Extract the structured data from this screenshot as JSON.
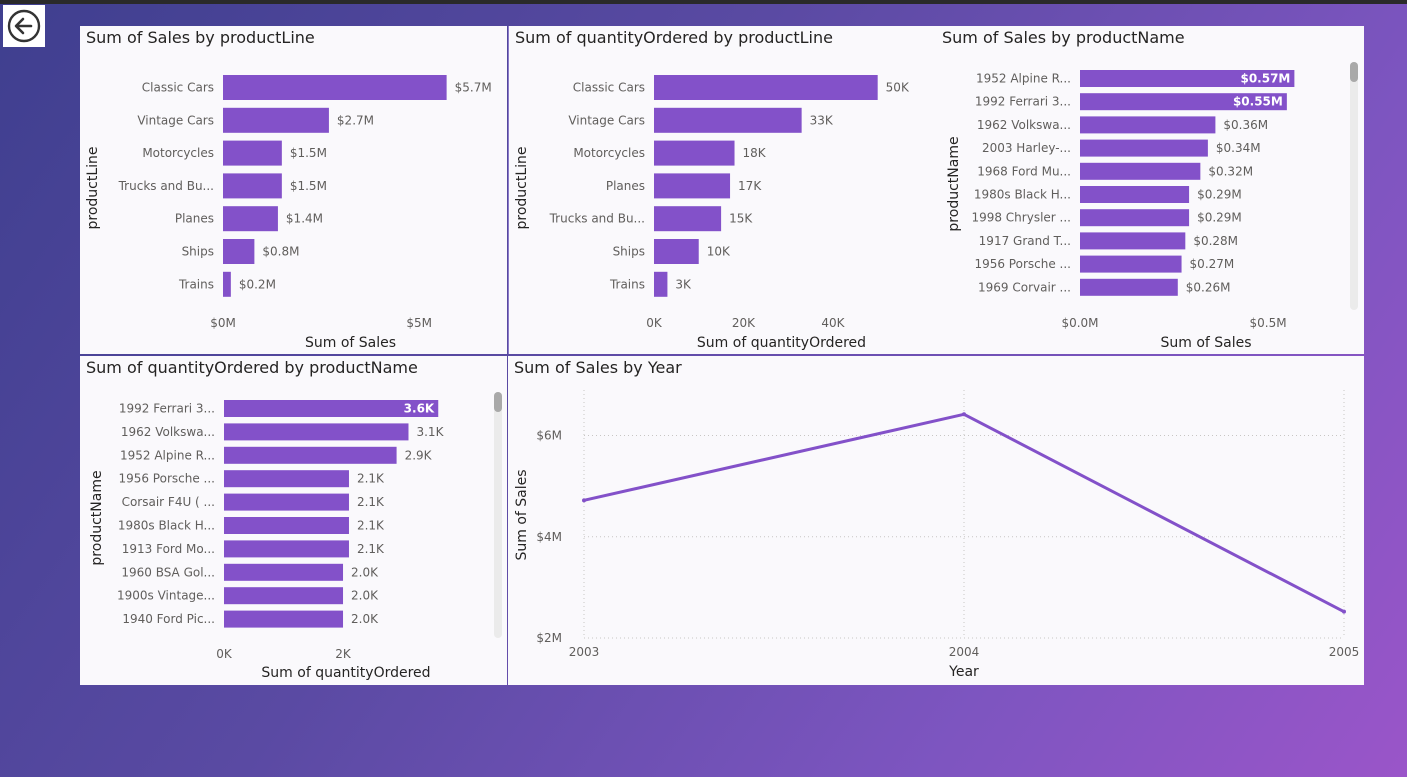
{
  "colors": {
    "bar": "#8351c9",
    "line": "#8351c9",
    "panel_bg": "#faf9fc",
    "text": "#605e5c"
  },
  "icons": {
    "back": "arrow-left-circle-icon"
  },
  "charts": [
    {
      "title": "Sum of Sales by productLine",
      "type": "bar",
      "orientation": "horizontal",
      "xlabel": "Sum of Sales",
      "ylabel": "productLine",
      "xlim": [
        0,
        6.5
      ],
      "x_ticks": [
        {
          "value": 0,
          "label": "$0M"
        },
        {
          "value": 5,
          "label": "$5M"
        }
      ],
      "categories": [
        "Classic Cars",
        "Vintage Cars",
        "Motorcycles",
        "Trucks and Bu...",
        "Planes",
        "Ships",
        "Trains"
      ],
      "values": [
        5.7,
        2.7,
        1.5,
        1.5,
        1.4,
        0.8,
        0.2
      ],
      "value_labels": [
        "$5.7M",
        "$2.7M",
        "$1.5M",
        "$1.5M",
        "$1.4M",
        "$0.8M",
        "$0.2M"
      ]
    },
    {
      "title": "Sum of quantityOrdered by productLine",
      "type": "bar",
      "orientation": "horizontal",
      "xlabel": "Sum of quantityOrdered",
      "ylabel": "productLine",
      "xlim": [
        0,
        57
      ],
      "x_ticks": [
        {
          "value": 0,
          "label": "0K"
        },
        {
          "value": 20,
          "label": "20K"
        },
        {
          "value": 40,
          "label": "40K"
        }
      ],
      "categories": [
        "Classic Cars",
        "Vintage Cars",
        "Motorcycles",
        "Planes",
        "Trucks and Bu...",
        "Ships",
        "Trains"
      ],
      "values": [
        50,
        33,
        18,
        17,
        15,
        10,
        3
      ],
      "value_labels": [
        "50K",
        "33K",
        "18K",
        "17K",
        "15K",
        "10K",
        "3K"
      ]
    },
    {
      "title": "Sum of Sales by productName",
      "type": "bar",
      "orientation": "horizontal",
      "xlabel": "Sum of Sales",
      "ylabel": "productName",
      "xlim": [
        0,
        0.67
      ],
      "x_ticks": [
        {
          "value": 0,
          "label": "$0.0M"
        },
        {
          "value": 0.5,
          "label": "$0.5M"
        }
      ],
      "categories": [
        "1952 Alpine R...",
        "1992 Ferrari 3...",
        "1962 Volkswa...",
        "2003 Harley-...",
        "1968 Ford Mu...",
        "1980s Black H...",
        "1998 Chrysler ...",
        "1917 Grand T...",
        "1956 Porsche ...",
        "1969 Corvair ..."
      ],
      "values": [
        0.57,
        0.55,
        0.36,
        0.34,
        0.32,
        0.29,
        0.29,
        0.28,
        0.27,
        0.26
      ],
      "value_labels": [
        "$0.57M",
        "$0.55M",
        "$0.36M",
        "$0.34M",
        "$0.32M",
        "$0.29M",
        "$0.29M",
        "$0.28M",
        "$0.27M",
        "$0.26M"
      ],
      "inside_labels": 2
    },
    {
      "title": "Sum of quantityOrdered by productName",
      "type": "bar",
      "orientation": "horizontal",
      "xlabel": "Sum of quantityOrdered",
      "ylabel": "productName",
      "xlim": [
        0,
        4.1
      ],
      "x_ticks": [
        {
          "value": 0,
          "label": "0K"
        },
        {
          "value": 2,
          "label": "2K"
        }
      ],
      "categories": [
        "1992 Ferrari 3...",
        "1962 Volkswa...",
        "1952 Alpine R...",
        "1956 Porsche ...",
        "Corsair F4U ( ...",
        "1980s Black H...",
        "1913 Ford Mo...",
        "1960 BSA Gol...",
        "1900s Vintage...",
        "1940 Ford Pic..."
      ],
      "values": [
        3.6,
        3.1,
        2.9,
        2.1,
        2.1,
        2.1,
        2.1,
        2.0,
        2.0,
        2.0
      ],
      "value_labels": [
        "3.6K",
        "3.1K",
        "2.9K",
        "2.1K",
        "2.1K",
        "2.1K",
        "2.1K",
        "2.0K",
        "2.0K",
        "2.0K"
      ],
      "inside_labels": 1
    },
    {
      "title": "Sum of Sales by Year",
      "type": "line",
      "xlabel": "Year",
      "ylabel": "Sum of Sales",
      "x": [
        "2003",
        "2004",
        "2005"
      ],
      "values": [
        4.72,
        6.42,
        2.52
      ],
      "ylim": [
        2,
        6.9
      ],
      "y_ticks": [
        {
          "value": 2,
          "label": "$2M"
        },
        {
          "value": 4,
          "label": "$4M"
        },
        {
          "value": 6,
          "label": "$6M"
        }
      ],
      "grid": true
    }
  ]
}
